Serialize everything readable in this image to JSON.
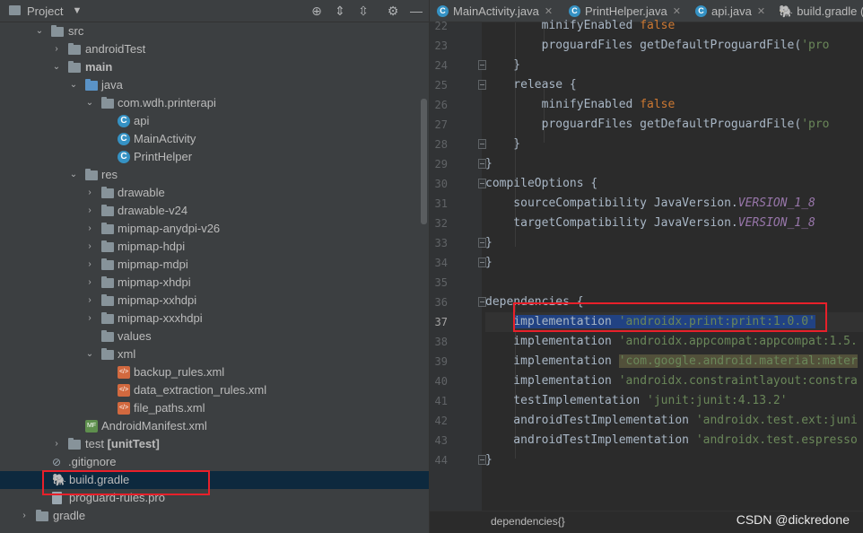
{
  "project_panel": {
    "title": "Project",
    "tree": [
      {
        "label": "src",
        "kind": "folder"
      },
      {
        "label": "androidTest",
        "kind": "folder"
      },
      {
        "label": "main",
        "kind": "folder-module"
      },
      {
        "label": "java",
        "kind": "folder-blue"
      },
      {
        "label": "com.wdh.printerapi",
        "kind": "package"
      },
      {
        "label": "api",
        "kind": "class"
      },
      {
        "label": "MainActivity",
        "kind": "class"
      },
      {
        "label": "PrintHelper",
        "kind": "class"
      },
      {
        "label": "res",
        "kind": "folder-res"
      },
      {
        "label": "drawable",
        "kind": "folder"
      },
      {
        "label": "drawable-v24",
        "kind": "folder"
      },
      {
        "label": "mipmap-anydpi-v26",
        "kind": "folder"
      },
      {
        "label": "mipmap-hdpi",
        "kind": "folder"
      },
      {
        "label": "mipmap-mdpi",
        "kind": "folder"
      },
      {
        "label": "mipmap-xhdpi",
        "kind": "folder"
      },
      {
        "label": "mipmap-xxhdpi",
        "kind": "folder"
      },
      {
        "label": "mipmap-xxxhdpi",
        "kind": "folder"
      },
      {
        "label": "values",
        "kind": "folder"
      },
      {
        "label": "xml",
        "kind": "folder"
      },
      {
        "label": "backup_rules.xml",
        "kind": "xml-file"
      },
      {
        "label": "data_extraction_rules.xml",
        "kind": "xml-file"
      },
      {
        "label": "file_paths.xml",
        "kind": "xml-file"
      },
      {
        "label": "AndroidManifest.xml",
        "kind": "manifest"
      },
      {
        "label": "test",
        "suffix": "[unitTest]",
        "kind": "folder"
      },
      {
        "label": ".gitignore",
        "kind": "file"
      },
      {
        "label": "build.gradle",
        "kind": "gradle",
        "selected": true
      },
      {
        "label": "proguard-rules.pro",
        "kind": "file"
      },
      {
        "label": "gradle",
        "kind": "folder"
      }
    ]
  },
  "tabs": [
    {
      "label": "MainActivity.java",
      "icon": "class-icon"
    },
    {
      "label": "PrintHelper.java",
      "icon": "class-icon"
    },
    {
      "label": "api.java",
      "icon": "class-icon"
    },
    {
      "label": "build.gradle (",
      "icon": "gradle-icon"
    }
  ],
  "editor": {
    "line_numbers": [
      "22",
      "23",
      "24",
      "25",
      "26",
      "27",
      "28",
      "29",
      "30",
      "31",
      "32",
      "33",
      "34",
      "35",
      "36",
      "37",
      "38",
      "39",
      "40",
      "41",
      "42",
      "43",
      "44"
    ],
    "current_line": "37",
    "lines": {
      "l22": [
        {
          "t": "        minifyEnabled ",
          "c": ""
        },
        {
          "t": "false",
          "c": "kw"
        }
      ],
      "l23": [
        {
          "t": "        proguardFiles getDefaultProguardFile(",
          "c": ""
        },
        {
          "t": "'pro",
          "c": "str"
        }
      ],
      "l24": [
        {
          "t": "    }",
          "c": ""
        }
      ],
      "l25": [
        {
          "t": "    release {",
          "c": ""
        }
      ],
      "l26": [
        {
          "t": "        minifyEnabled ",
          "c": ""
        },
        {
          "t": "false",
          "c": "kw"
        }
      ],
      "l27": [
        {
          "t": "        proguardFiles getDefaultProguardFile(",
          "c": ""
        },
        {
          "t": "'pro",
          "c": "str"
        }
      ],
      "l28": [
        {
          "t": "    }",
          "c": ""
        }
      ],
      "l29": [
        {
          "t": "}",
          "c": ""
        }
      ],
      "l30": [
        {
          "t": "compileOptions {",
          "c": ""
        }
      ],
      "l31": [
        {
          "t": "    sourceCompatibility JavaVersion.",
          "c": ""
        },
        {
          "t": "VERSION_1_8",
          "c": "con"
        }
      ],
      "l32": [
        {
          "t": "    targetCompatibility JavaVersion.",
          "c": ""
        },
        {
          "t": "VERSION_1_8",
          "c": "con"
        }
      ],
      "l33": [
        {
          "t": "}",
          "c": ""
        }
      ],
      "l34": [
        {
          "t": "}",
          "c": ""
        }
      ],
      "l35": [
        {
          "t": "",
          "c": ""
        }
      ],
      "l36": [
        {
          "t": "dependencies {",
          "c": ""
        }
      ],
      "l37": [
        {
          "t": "    ",
          "c": ""
        },
        {
          "t": "implementation ",
          "c": "sel"
        },
        {
          "t": "'androidx.print:print:1.0.0'",
          "c": "str sel"
        }
      ],
      "l38": [
        {
          "t": "    implementation ",
          "c": ""
        },
        {
          "t": "'androidx.appcompat:appcompat:1.5.",
          "c": "str"
        }
      ],
      "l39": [
        {
          "t": "    implementation ",
          "c": ""
        },
        {
          "t": "'com.google.android.material:mater",
          "c": "str warn"
        }
      ],
      "l40": [
        {
          "t": "    implementation ",
          "c": ""
        },
        {
          "t": "'androidx.constraintlayout:constra",
          "c": "str"
        }
      ],
      "l41": [
        {
          "t": "    testImplementation ",
          "c": ""
        },
        {
          "t": "'junit:junit:4.13.2'",
          "c": "str"
        }
      ],
      "l42": [
        {
          "t": "    androidTestImplementation ",
          "c": ""
        },
        {
          "t": "'androidx.test.ext:juni",
          "c": "str"
        }
      ],
      "l43": [
        {
          "t": "    androidTestImplementation ",
          "c": ""
        },
        {
          "t": "'androidx.test.espresso",
          "c": "str"
        }
      ],
      "l44": [
        {
          "t": "}",
          "c": ""
        }
      ]
    },
    "breadcrumb": "dependencies{}"
  },
  "watermark": "CSDN @dickredone",
  "colors": {
    "highlight_box": "#e8202a",
    "selection": "#214283",
    "keyword": "#cc7832",
    "string": "#6a8759"
  }
}
